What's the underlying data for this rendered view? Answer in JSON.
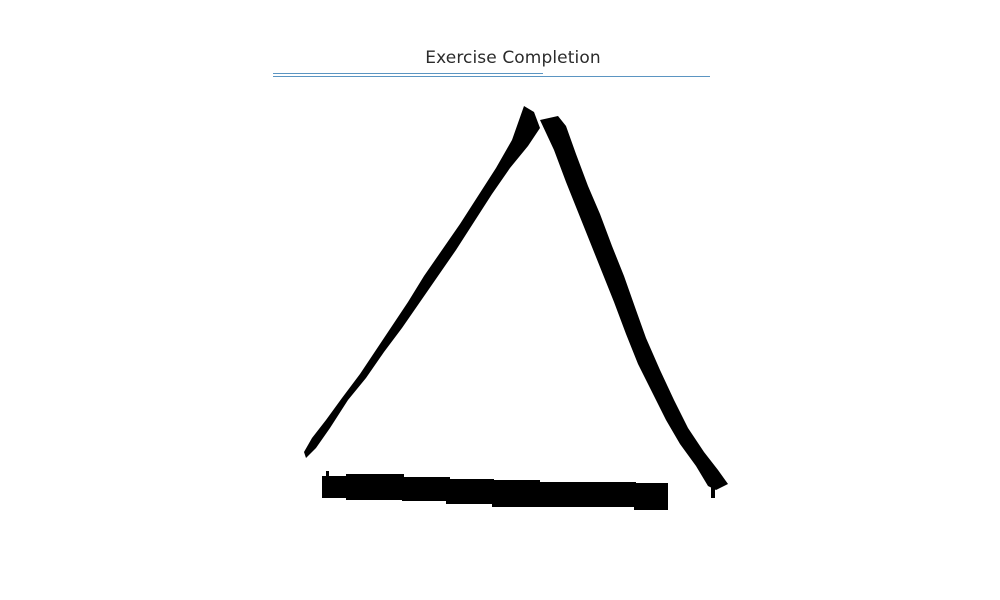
{
  "header": {
    "title": "Exercise Completion"
  },
  "colors": {
    "rule": "#5b95c2",
    "ink": "#000000",
    "background": "#ffffff"
  },
  "drawing": {
    "shape": "triangle",
    "style": "hand-drawn"
  }
}
